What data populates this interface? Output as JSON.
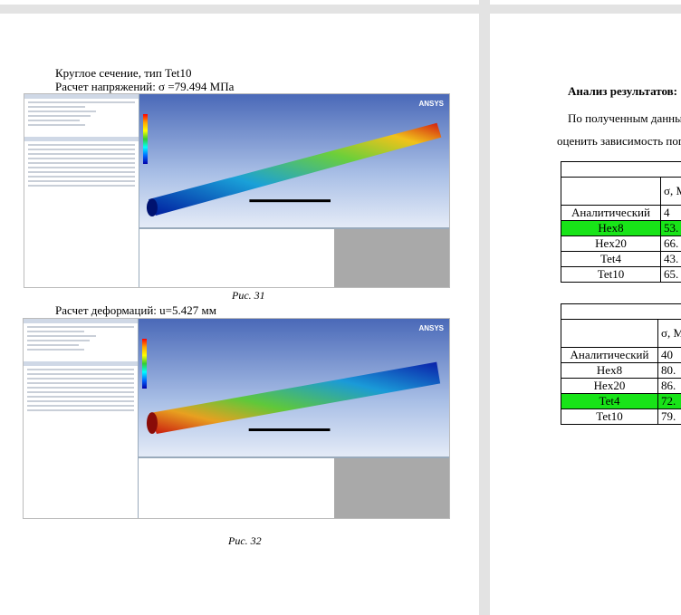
{
  "page1": {
    "heading1": "Круглое сечение, тип Tet10",
    "heading2": "Расчет напряжений: σ =79.494 МПа",
    "caption1": "Рис. 31",
    "heading3": "Расчет деформаций: u=5.427 мм",
    "caption2": "Рис. 32",
    "logo": "ANSYS"
  },
  "page2": {
    "title": "Анализ результатов:",
    "para1": "По полученным данны",
    "para2": "оценить зависимость пог",
    "table1": {
      "col2": "σ, М",
      "rows": [
        [
          "Аналитический",
          "4"
        ],
        [
          "Hex8",
          "53."
        ],
        [
          "Hex20",
          "66."
        ],
        [
          "Tet4",
          "43."
        ],
        [
          "Tet10",
          "65."
        ]
      ],
      "highlight": 1
    },
    "table2": {
      "col2": "σ, М",
      "rows": [
        [
          "Аналитический",
          "40"
        ],
        [
          "Hex8",
          "80."
        ],
        [
          "Hex20",
          "86."
        ],
        [
          "Tet4",
          "72."
        ],
        [
          "Tet10",
          "79."
        ]
      ],
      "highlight": 3
    },
    "highlight_color": "#18e418"
  }
}
